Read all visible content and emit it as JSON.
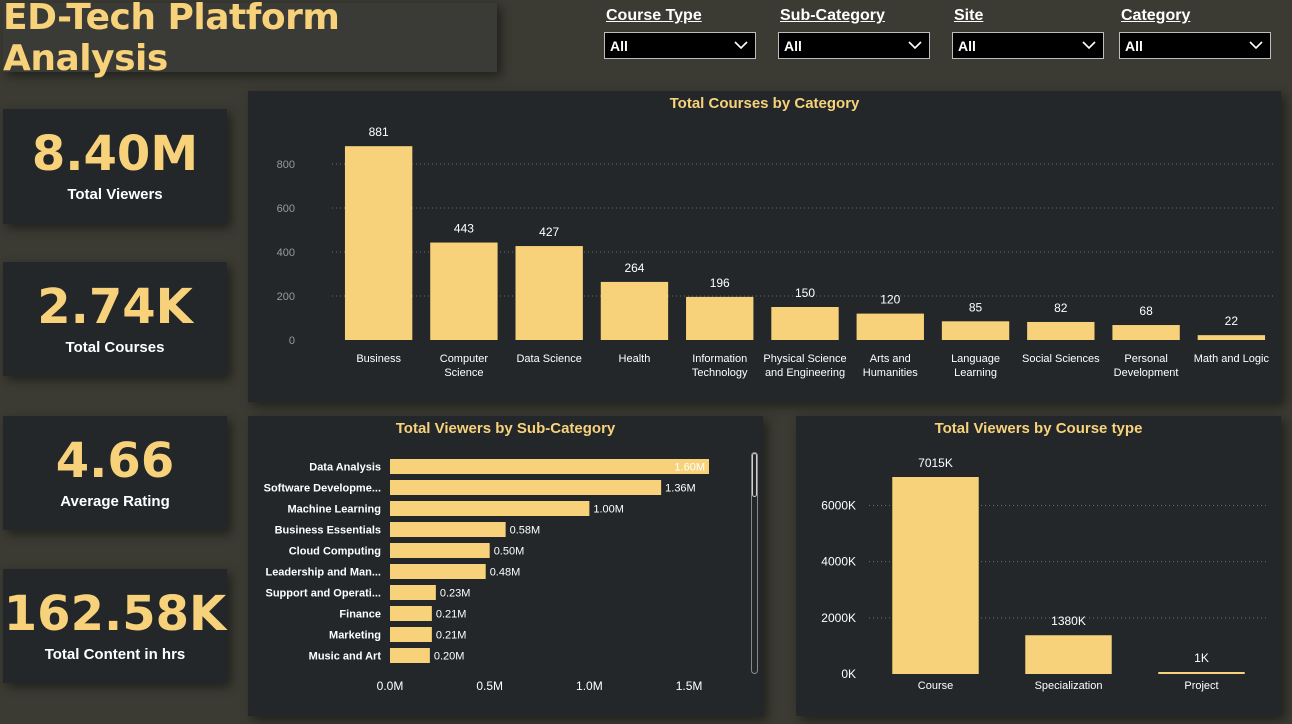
{
  "header": {
    "title": "ED-Tech Platform Analysis"
  },
  "filters": [
    {
      "label": "Course Type",
      "value": "All"
    },
    {
      "label": "Sub-Category",
      "value": "All"
    },
    {
      "label": "Site",
      "value": "All"
    },
    {
      "label": "Category",
      "value": "All"
    }
  ],
  "kpis": [
    {
      "value": "8.40M",
      "label": "Total Viewers"
    },
    {
      "value": "2.74K",
      "label": "Total Courses"
    },
    {
      "value": "4.66",
      "label": "Average Rating"
    },
    {
      "value": "162.58K",
      "label": "Total Content in hrs"
    }
  ],
  "colors": {
    "accent": "#f7d27a",
    "panel": "#23272a",
    "background": "#3b3b33"
  },
  "chart_data": [
    {
      "type": "bar",
      "title": "Total Courses by Category",
      "categories": [
        "Business",
        "Computer Science",
        "Data Science",
        "Health",
        "Information Technology",
        "Physical Science and Engineering",
        "Arts and Humanities",
        "Language Learning",
        "Social Sciences",
        "Personal Development",
        "Math and Logic"
      ],
      "category_lines": [
        [
          "Business"
        ],
        [
          "Computer",
          "Science"
        ],
        [
          "Data Science"
        ],
        [
          "Health"
        ],
        [
          "Information",
          "Technology"
        ],
        [
          "Physical Science",
          "and Engineering"
        ],
        [
          "Arts and",
          "Humanities"
        ],
        [
          "Language",
          "Learning"
        ],
        [
          "Social Sciences"
        ],
        [
          "Personal",
          "Development"
        ],
        [
          "Math and Logic"
        ]
      ],
      "values": [
        881,
        443,
        427,
        264,
        196,
        150,
        120,
        85,
        82,
        68,
        22
      ],
      "data_labels": [
        "881",
        "443",
        "427",
        "264",
        "196",
        "150",
        "120",
        "85",
        "82",
        "68",
        "22"
      ],
      "ylim": [
        0,
        950
      ],
      "yticks": [
        0,
        200,
        400,
        600,
        800
      ],
      "ytick_labels": [
        "0",
        "200",
        "400",
        "600",
        "800"
      ],
      "grid": true
    },
    {
      "type": "bar",
      "orientation": "horizontal",
      "title": "Total Viewers by Sub-Category",
      "categories": [
        "Data Analysis",
        "Software Developme...",
        "Machine Learning",
        "Business Essentials",
        "Cloud Computing",
        "Leadership and Man...",
        "Support and Operati...",
        "Finance",
        "Marketing",
        "Music and Art"
      ],
      "values": [
        1.6,
        1.36,
        1.0,
        0.58,
        0.5,
        0.48,
        0.23,
        0.21,
        0.21,
        0.2
      ],
      "data_labels": [
        "1.60M",
        "1.36M",
        "1.00M",
        "0.58M",
        "0.50M",
        "0.48M",
        "0.23M",
        "0.21M",
        "0.21M",
        "0.20M"
      ],
      "xlim": [
        0,
        1.6
      ],
      "xticks": [
        0,
        0.5,
        1.0,
        1.5
      ],
      "xtick_labels": [
        "0.0M",
        "0.5M",
        "1.0M",
        "1.5M"
      ],
      "unit": "M"
    },
    {
      "type": "bar",
      "title": "Total Viewers by Course type",
      "categories": [
        "Course",
        "Specialization",
        "Project"
      ],
      "values": [
        7015,
        1380,
        1
      ],
      "data_labels": [
        "7015K",
        "1380K",
        "1K"
      ],
      "ylim": [
        0,
        7015
      ],
      "yticks": [
        0,
        2000,
        4000,
        6000
      ],
      "ytick_labels": [
        "0K",
        "2000K",
        "4000K",
        "6000K"
      ],
      "grid": true,
      "unit": "K"
    }
  ]
}
